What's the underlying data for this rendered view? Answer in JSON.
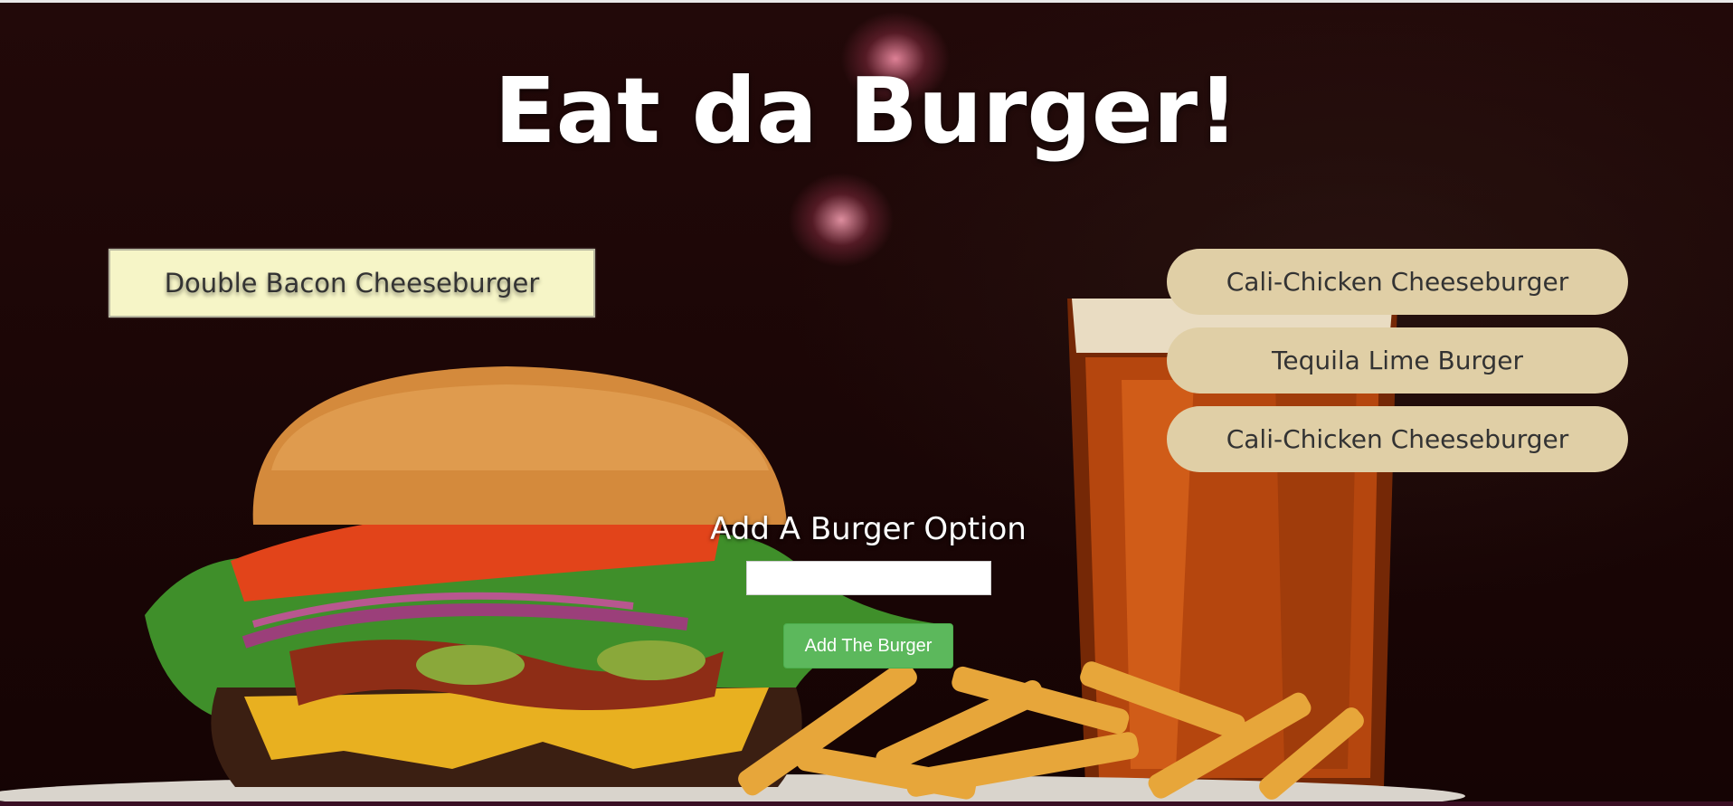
{
  "header": {
    "title": "Eat da Burger!"
  },
  "devoured": {
    "items": [
      {
        "label": "Double Bacon Cheeseburger"
      }
    ]
  },
  "menu": {
    "items": [
      {
        "label": "Cali-Chicken Cheeseburger"
      },
      {
        "label": "Tequila Lime Burger"
      },
      {
        "label": "Cali-Chicken Cheeseburger"
      }
    ]
  },
  "form": {
    "label": "Add A Burger Option",
    "input_value": "",
    "input_placeholder": "",
    "submit_label": "Add The Burger"
  },
  "background": {
    "description_icon": "burger-fries-beer-photo",
    "accent_colors": {
      "pill": "#e0cfa6",
      "devoured": "#f6f5c7",
      "button": "#5cb85c"
    }
  }
}
